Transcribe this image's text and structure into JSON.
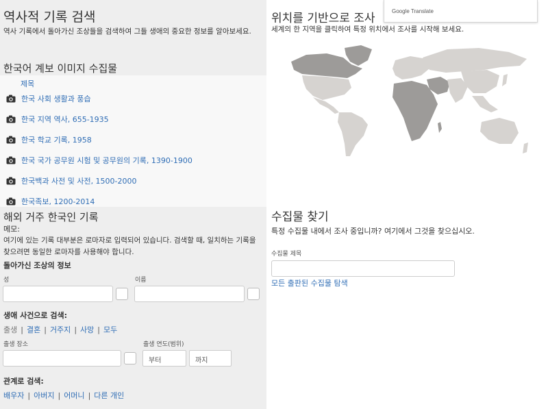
{
  "left": {
    "heading": "역사적 기록 검색",
    "intro": "역사 기록에서 돌아가신 조상들을 검색하여 그들 생애의 중요한 정보를 알아보세요.",
    "image_collection": {
      "heading": "한국어 계보 이미지 수집물",
      "column_header": "제목",
      "icon": "camera-icon",
      "items": [
        {
          "title": "한국 사회 생활과 풍습"
        },
        {
          "title": "한국 지역 역사, 655-1935"
        },
        {
          "title": "한국 학교 기록, 1958"
        },
        {
          "title": "한국 국가 공무원 시험 및 공무원의 기록, 1390-1900"
        },
        {
          "title": "한국백과 사전 및 사전, 1500-2000"
        },
        {
          "title": "한국족보, 1200-2014"
        }
      ]
    },
    "overseas": {
      "heading": "해외 거주 한국인 기록",
      "memo_label": "메모:",
      "memo_text": "여기에 있는 기록 대부분은 로마자로 입력되어 있습니다. 검색할 때, 일치하는 기록을 찾으려면 동일한 로마자를 사용해야 합니다."
    },
    "deceased": {
      "title": "돌아가신 조상의 정보",
      "surname_label": "성",
      "given_name_label": "이름"
    },
    "life_events": {
      "title": "생애 사건으로 검색:",
      "tabs": [
        "출생",
        "결혼",
        "거주지",
        "사망",
        "모두"
      ],
      "birthplace_label": "출생 장소",
      "birth_year_label": "출생 연도(범위)",
      "from_placeholder": "부터",
      "to_placeholder": "까지"
    },
    "relationships": {
      "title": "관계로 검색:",
      "items": [
        "배우자",
        "아버지",
        "어머니",
        "다른 개인"
      ]
    }
  },
  "right": {
    "map_title": "위치를 기반으로 조사",
    "map_desc": "세계의 한 지역을 클릭하여 특정 위치에서 조사를 시작해 보세요.",
    "google_translate": "Google Translate",
    "collections": {
      "title": "수집물 찾기",
      "desc": "특정 수집물 내에서 조사 중입니까? 여기에서 그것을 찾으십시오.",
      "input_label": "수집물 제목",
      "browse_link": "모든 출판된 수집물 탐색"
    }
  },
  "colors": {
    "link": "#2f6db5",
    "left_panel_bg": "#eeeeee",
    "map_land_light": "#d6d3d0",
    "map_land_dark": "#9d9b99"
  }
}
